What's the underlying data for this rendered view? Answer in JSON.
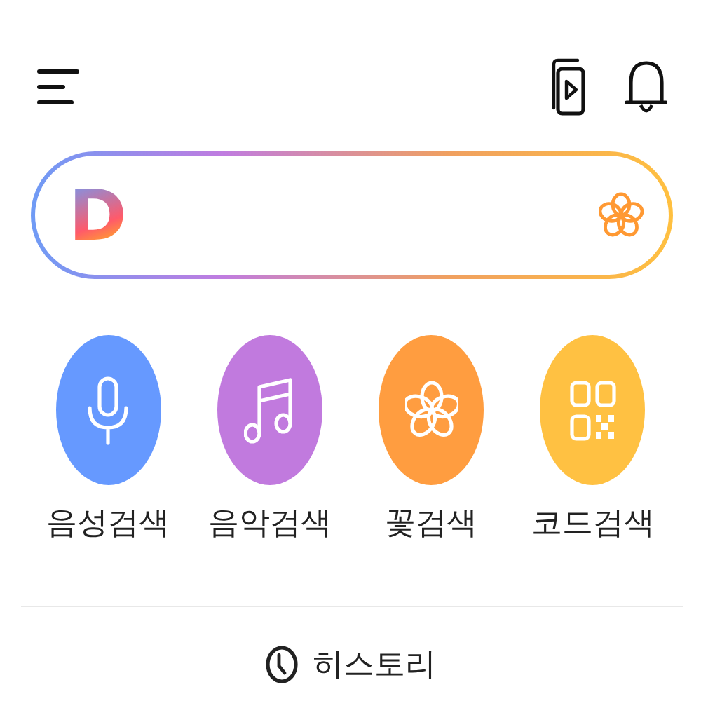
{
  "search": {
    "logo": "D"
  },
  "shortcuts": [
    {
      "kind": "voice",
      "label": "음성검색",
      "color": "#6699ff"
    },
    {
      "kind": "music",
      "label": "음악검색",
      "color": "#c17ade"
    },
    {
      "kind": "flower",
      "label": "꽃검색",
      "color": "#ff9d40"
    },
    {
      "kind": "code",
      "label": "코드검색",
      "color": "#ffc142"
    }
  ],
  "history": {
    "label": "히스토리"
  }
}
